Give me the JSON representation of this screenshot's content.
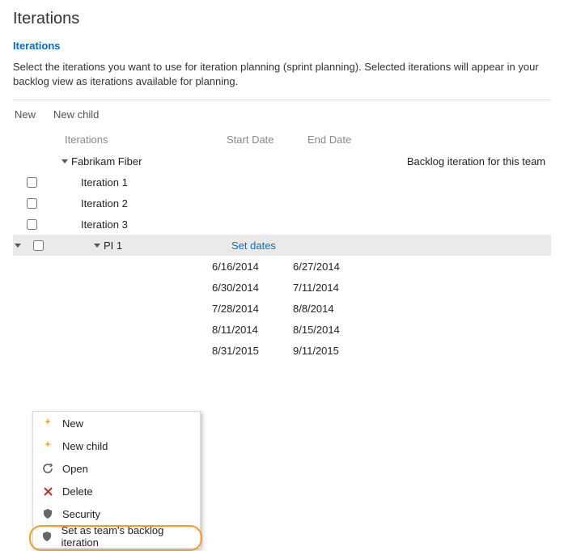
{
  "title": "Iterations",
  "section": "Iterations",
  "description": "Select the iterations you want to use for iteration planning (sprint planning). Selected iterations will appear in your backlog view as iterations available for planning.",
  "toolbar": {
    "new": "New",
    "newChild": "New child"
  },
  "columns": {
    "name": "Iterations",
    "start": "Start Date",
    "end": "End Date"
  },
  "root": {
    "name": "Fabrikam Fiber",
    "note": "Backlog iteration for this team"
  },
  "topIterations": [
    "Iteration 1",
    "Iteration 2",
    "Iteration 3"
  ],
  "selected": {
    "name": "PI 1",
    "setDates": "Set dates"
  },
  "dateRows": [
    {
      "start": "6/16/2014",
      "end": "6/27/2014"
    },
    {
      "start": "6/30/2014",
      "end": "7/11/2014"
    },
    {
      "start": "7/28/2014",
      "end": "8/8/2014"
    },
    {
      "start": "8/11/2014",
      "end": "8/15/2014"
    },
    {
      "start": "8/31/2015",
      "end": "9/11/2015"
    }
  ],
  "menu": {
    "new": "New",
    "newChild": "New child",
    "open": "Open",
    "delete": "Delete",
    "security": "Security",
    "setBacklog": "Set as team's backlog iteration"
  }
}
